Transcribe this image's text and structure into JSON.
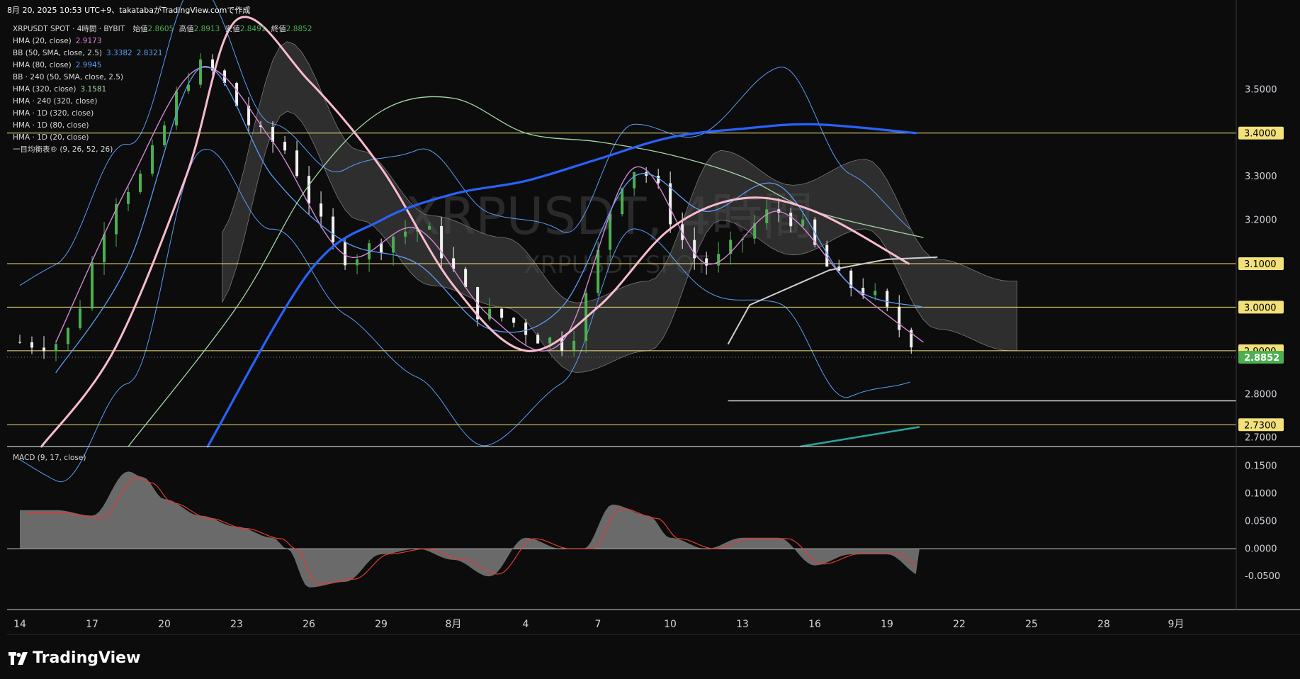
{
  "snapshot_text": "8月 20, 2025 10:53 UTC+9、takatabaがTradingView.comで作成",
  "watermark_title": "XRPUSDT, 4時間",
  "watermark_subtitle": "XRPUSDT SPOT",
  "legend": {
    "title": "XRPUSDT SPOT · 4時間 · BYBIT",
    "ohlc": {
      "open_label": "始値",
      "open": "2.8605",
      "high_label": "高値",
      "high": "2.8913",
      "low_label": "安値",
      "low": "2.8491",
      "close_label": "終値",
      "close": "2.8852"
    },
    "rows": [
      {
        "label": "HMA (20, close)",
        "value": "2.9173",
        "color": "#d386d6"
      },
      {
        "label": "BB (50, SMA, close, 2.5)",
        "value": "3.3382",
        "value2": "2.8321",
        "color": "#5b9cf6"
      },
      {
        "label": "HMA (80, close)",
        "value": "2.9945",
        "color": "#5b9cf6"
      },
      {
        "label": "BB · 240 (50, SMA, close, 2.5)",
        "value": "",
        "color": "#d8d8d8"
      },
      {
        "label": "HMA (320, close)",
        "value": "3.1581",
        "color": "#a5d6a7"
      },
      {
        "label": "HMA · 240 (320, close)",
        "value": "",
        "color": "#d8d8d8"
      },
      {
        "label": "HMA · 1D (320, close)",
        "value": "",
        "color": "#d8d8d8"
      },
      {
        "label": "HMA · 1D (80, close)",
        "value": "",
        "color": "#d8d8d8"
      },
      {
        "label": "HMA · 1D (20, close)",
        "value": "",
        "color": "#d8d8d8"
      },
      {
        "label": "一目均衡表® (9, 26, 52, 26)",
        "value": "",
        "color": "#d8d8d8"
      }
    ]
  },
  "macd_label": "MACD (9, 17, close)",
  "brand": "TradingView",
  "colors": {
    "up": "#4caf50",
    "down": "#f2f2f2",
    "hline": "#f2e17a",
    "last_price_bg": "#4caf50",
    "bb": "#5b9cf6",
    "hma20": "#d386d6",
    "hma80": "#5b9cf6",
    "hma320": "#a5d6a7",
    "hma1d": "#f8bbd0",
    "hma_blue": "#2962ff"
  },
  "chart_data": [
    {
      "type": "line",
      "title": "XRPUSDT SPOT · 4時間 · BYBIT",
      "ylim": [
        2.68,
        3.66
      ],
      "x_ticks": [
        "14",
        "17",
        "20",
        "23",
        "26",
        "29",
        "8月",
        "4",
        "7",
        "10",
        "13",
        "16",
        "19",
        "22",
        "25",
        "28",
        "9月"
      ],
      "y_ticks": [
        "3.5000",
        "3.3000",
        "3.2000",
        "2.8000",
        "2.7000"
      ],
      "price_labels": [
        {
          "value": 3.4,
          "text": "3.4000",
          "kind": "hline"
        },
        {
          "value": 3.1,
          "text": "3.1000",
          "kind": "hline"
        },
        {
          "value": 3.0,
          "text": "3.0000",
          "kind": "hline"
        },
        {
          "value": 2.9,
          "text": "2.9000",
          "kind": "hline"
        },
        {
          "value": 2.73,
          "text": "2.7300",
          "kind": "hline"
        },
        {
          "value": 2.8852,
          "text": "2.8852",
          "kind": "last"
        }
      ],
      "series": [
        {
          "name": "HMA (20, close)",
          "x": [
            0.5,
            1.5,
            2.5,
            3.5,
            4.5,
            5.5,
            6.5,
            7.5,
            8.5,
            9.5,
            10.5,
            11.5,
            12.5
          ],
          "values": [
            2.92,
            3.28,
            3.55,
            3.38,
            3.12,
            3.18,
            2.98,
            2.92,
            3.32,
            3.1,
            3.22,
            3.05,
            2.92
          ]
        },
        {
          "name": "HMA (80, close)",
          "x": [
            0.5,
            1.5,
            2.5,
            3.5,
            4.5,
            5.5,
            6.5,
            7.5,
            8.5,
            9.5,
            10.5,
            11.5,
            12.5
          ],
          "values": [
            2.85,
            3.1,
            3.55,
            3.3,
            3.15,
            3.1,
            2.95,
            3.0,
            3.3,
            3.22,
            3.28,
            3.05,
            3.0
          ]
        },
        {
          "name": "HMA (320, close)",
          "x": [
            1.5,
            3,
            4,
            5,
            6,
            7,
            8,
            9,
            10,
            11,
            12.5
          ],
          "values": [
            2.68,
            3.0,
            3.28,
            3.45,
            3.48,
            3.4,
            3.38,
            3.35,
            3.3,
            3.22,
            3.16
          ]
        },
        {
          "name": "HMA · 1D",
          "x": [
            0.3,
            1.3,
            2.3,
            3.0,
            4.0,
            5.0,
            6.0,
            7.0,
            8.0,
            9.0,
            10.0,
            11.0,
            12.3
          ],
          "values": [
            2.68,
            2.9,
            3.3,
            3.66,
            3.52,
            3.32,
            3.05,
            2.9,
            3.0,
            3.18,
            3.25,
            3.22,
            3.1
          ]
        },
        {
          "name": "HMA (blue)",
          "x": [
            2.6,
            4,
            5,
            6,
            7,
            8,
            9,
            10,
            11,
            12.4
          ],
          "values": [
            2.68,
            3.08,
            3.2,
            3.26,
            3.29,
            3.34,
            3.39,
            3.41,
            3.42,
            3.4
          ]
        }
      ]
    },
    {
      "type": "area",
      "title": "MACD (9, 17, close)",
      "ylim": [
        -0.11,
        0.18
      ],
      "y_ticks": [
        "0.1500",
        "0.1000",
        "0.0500",
        "0.0000",
        "-0.0500"
      ],
      "x": [
        0,
        0.5,
        1,
        1.5,
        1.7,
        2,
        2.5,
        3,
        3.5,
        3.7,
        4,
        4.5,
        5,
        5.5,
        6,
        6.5,
        7,
        7.5,
        7.8,
        8.2,
        8.7,
        9,
        9.5,
        10,
        10.5,
        11,
        11.5,
        12,
        12.5
      ],
      "values": [
        0.07,
        0.07,
        0.06,
        0.14,
        0.13,
        0.09,
        0.06,
        0.04,
        0.02,
        0.0,
        -0.07,
        -0.06,
        -0.01,
        0.0,
        -0.02,
        -0.05,
        0.02,
        0.0,
        0.0,
        0.08,
        0.06,
        0.02,
        0.0,
        0.02,
        0.02,
        -0.03,
        -0.01,
        -0.01,
        -0.05
      ]
    }
  ]
}
